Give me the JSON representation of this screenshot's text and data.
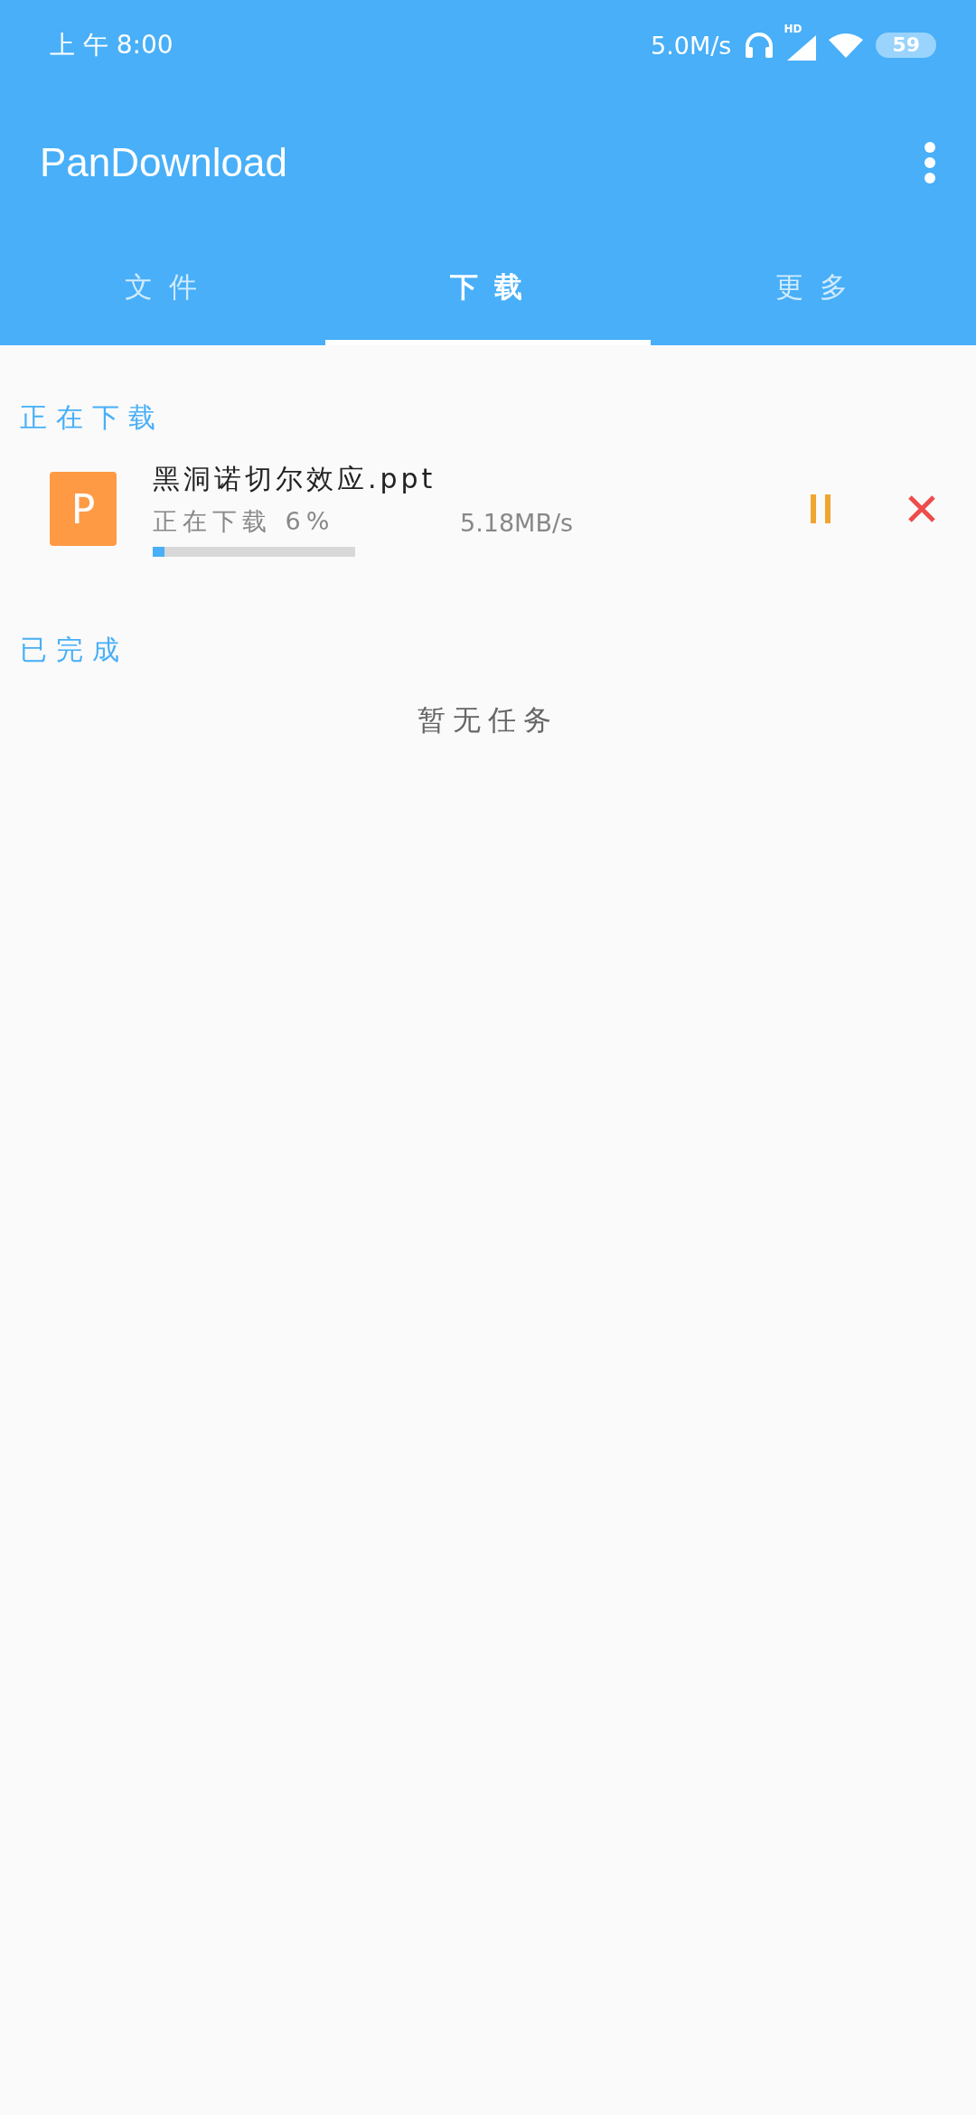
{
  "status_bar": {
    "time": "上 午 8:00",
    "net_speed": "5.0M/s",
    "signal_label": "HD",
    "battery": "59"
  },
  "app_bar": {
    "title": "PanDownload"
  },
  "tabs": [
    {
      "label": "文 件",
      "selected": false
    },
    {
      "label": "下 载",
      "selected": true
    },
    {
      "label": "更 多",
      "selected": false
    }
  ],
  "downloading": {
    "heading": "正在下载",
    "items": [
      {
        "file_icon_letter": "P",
        "name": "黑洞诺切尔效应.ppt",
        "status": "正在下载 6%",
        "level": 0.06,
        "speed": "5.18MB/s"
      }
    ]
  },
  "completed": {
    "heading": "已完成",
    "empty_text": "暂无任务"
  }
}
